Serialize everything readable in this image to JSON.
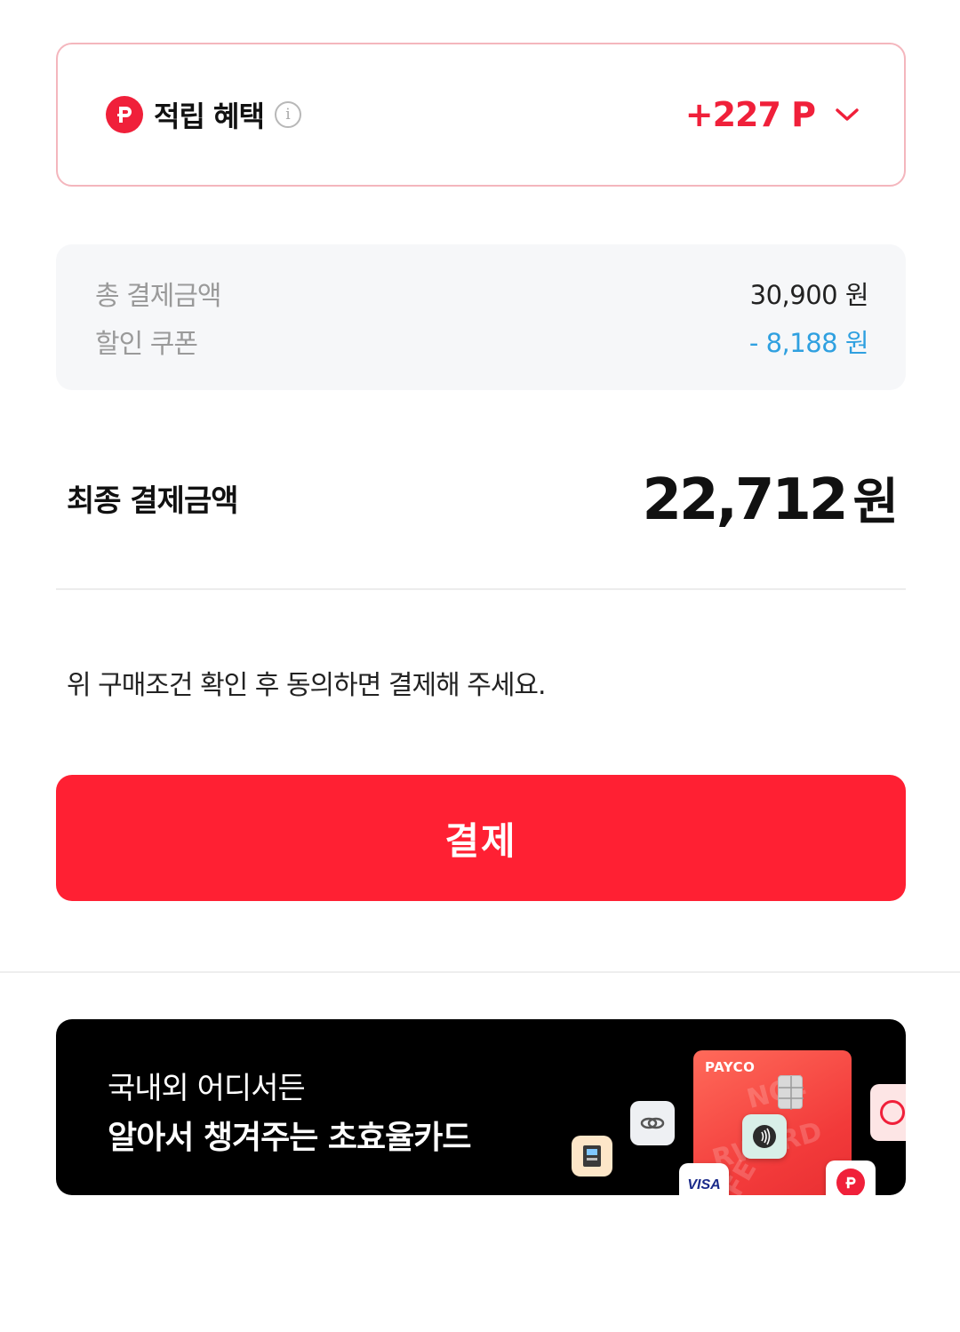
{
  "reward": {
    "title": "적립 혜택",
    "points": "+227 P",
    "badge_letter": "P",
    "accent_color": "#f0203a"
  },
  "summary": {
    "rows": [
      {
        "label": "총 결제금액",
        "value": "30,900 원"
      },
      {
        "label": "할인 쿠폰",
        "value": "- 8,188 원"
      }
    ],
    "discount_color": "#2fa0e0"
  },
  "final": {
    "label": "최종 결제금액",
    "amount": "22,712",
    "unit": "원"
  },
  "notice": "위 구매조건 확인 후 동의하면 결제해 주세요.",
  "pay_button": {
    "label": "결제",
    "color": "#ff2033"
  },
  "banner": {
    "line1": "국내외 어디서든",
    "line2": "알아서 챙겨주는 초효율카드",
    "card_brand": "PAYCO",
    "visa_label": "VISA"
  },
  "icons": [
    "payco-point-icon",
    "info-icon",
    "chevron-down-icon",
    "chip-icon",
    "contactless-icon",
    "atm-icon",
    "visa-icon"
  ]
}
